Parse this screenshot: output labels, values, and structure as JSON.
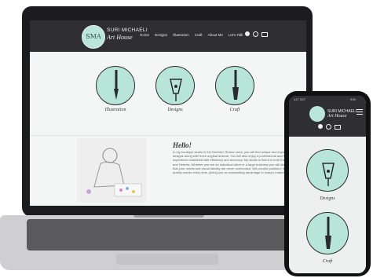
{
  "site": {
    "brand_name": "SURI MICHAELI",
    "brand_sub": "Art House",
    "logo_text": "SMA"
  },
  "nav": {
    "items": [
      "Home",
      "Designs",
      "Illustration",
      "Craft",
      "About Me",
      "Let's Talk"
    ],
    "icons": [
      "facebook-icon",
      "whatsapp-icon",
      "mail-icon"
    ]
  },
  "services": [
    {
      "label": "Illustration",
      "icon": "pen-nib-icon"
    },
    {
      "label": "Designs",
      "icon": "fountain-pen-icon"
    },
    {
      "label": "Craft",
      "icon": "paintbrush-icon"
    }
  ],
  "about": {
    "heading": "Hello!",
    "body": "In my boutique studio in the Northern Sharon area, you will find unique and impeccable designs along with fresh original artwork. You will also enjoy a professional and friendly experience combined with efficiency and accuracy. My studio is fluent in both English and Hebrew. Whether you are an individual client or a large business you will discover that your needs and visual identity are never overlooked. We provide polished, high-quality results every time, giving you an outstanding advantage in today's market."
  },
  "phone": {
    "status_time": "4:27 CDT",
    "status_right": "9:00",
    "cards": [
      {
        "label": "Designs"
      },
      {
        "label": "Craft"
      }
    ]
  },
  "colors": {
    "header_bg": "#2f2f31",
    "accent_mint": "#b7e6d8",
    "page_bg": "#f4f5f5"
  }
}
